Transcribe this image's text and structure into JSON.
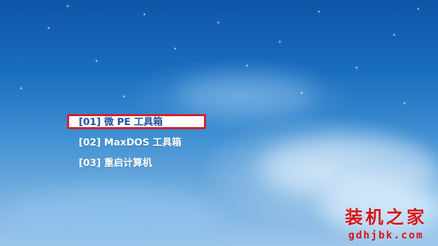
{
  "boot_menu": {
    "items": [
      {
        "label": "[01] 微 PE 工具箱",
        "selected": true
      },
      {
        "label": "[02] MaxDOS 工具箱",
        "selected": false
      },
      {
        "label": "[03] 重启计算机",
        "selected": false
      }
    ]
  },
  "watermark": {
    "title": "装机之家",
    "url": "gdhjbk.com"
  },
  "colors": {
    "sky_top": "#0f54a8",
    "sky_bottom": "#9cc6ea",
    "selection_border": "#d2202a",
    "selection_text": "#1d4f9e",
    "watermark": "#d8131a"
  }
}
